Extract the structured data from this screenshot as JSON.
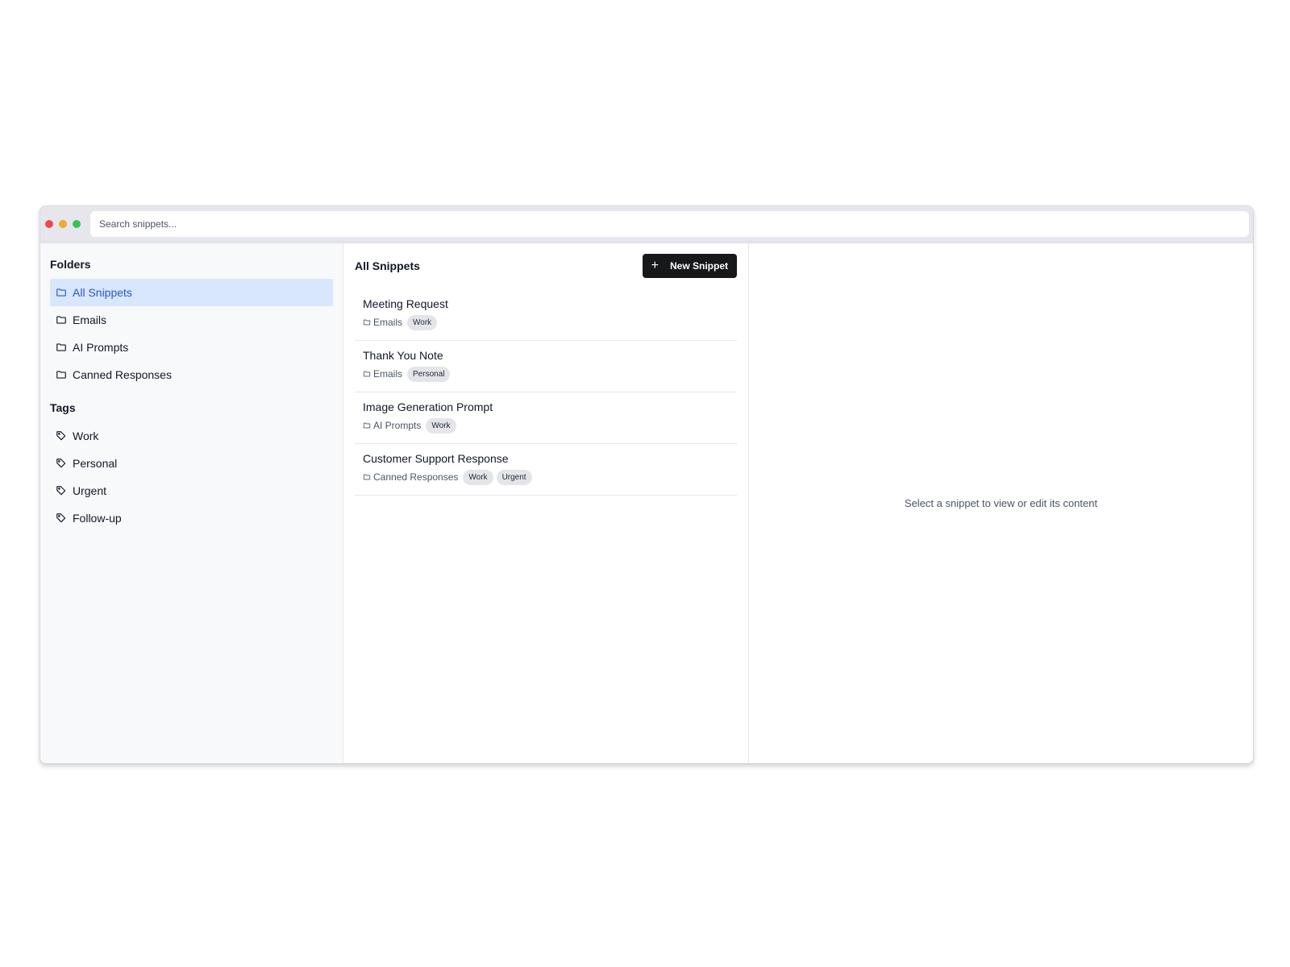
{
  "search": {
    "placeholder": "Search snippets..."
  },
  "sidebar": {
    "folders_title": "Folders",
    "folders": [
      {
        "label": "All Snippets",
        "active": true,
        "icon": "folder-icon"
      },
      {
        "label": "Emails",
        "active": false,
        "icon": "folder-icon"
      },
      {
        "label": "AI Prompts",
        "active": false,
        "icon": "folder-icon"
      },
      {
        "label": "Canned Responses",
        "active": false,
        "icon": "folder-icon"
      }
    ],
    "tags_title": "Tags",
    "tags": [
      {
        "label": "Work",
        "icon": "tag-icon"
      },
      {
        "label": "Personal",
        "icon": "tag-icon"
      },
      {
        "label": "Urgent",
        "icon": "tag-icon"
      },
      {
        "label": "Follow-up",
        "icon": "tag-icon"
      }
    ]
  },
  "list": {
    "title": "All Snippets",
    "new_button_label": "New Snippet",
    "snippets": [
      {
        "title": "Meeting Request",
        "folder": "Emails",
        "tags": [
          "Work"
        ]
      },
      {
        "title": "Thank You Note",
        "folder": "Emails",
        "tags": [
          "Personal"
        ]
      },
      {
        "title": "Image Generation Prompt",
        "folder": "AI Prompts",
        "tags": [
          "Work"
        ]
      },
      {
        "title": "Customer Support Response",
        "folder": "Canned Responses",
        "tags": [
          "Work",
          "Urgent"
        ]
      }
    ]
  },
  "detail": {
    "empty_message": "Select a snippet to view or edit its content"
  },
  "colors": {
    "accent": "#2556d6",
    "active_bg": "#d9e7fc",
    "button_bg": "#17181a",
    "close": "#ee4a4a",
    "minimize": "#f0aa2c",
    "maximize": "#38c15a"
  }
}
